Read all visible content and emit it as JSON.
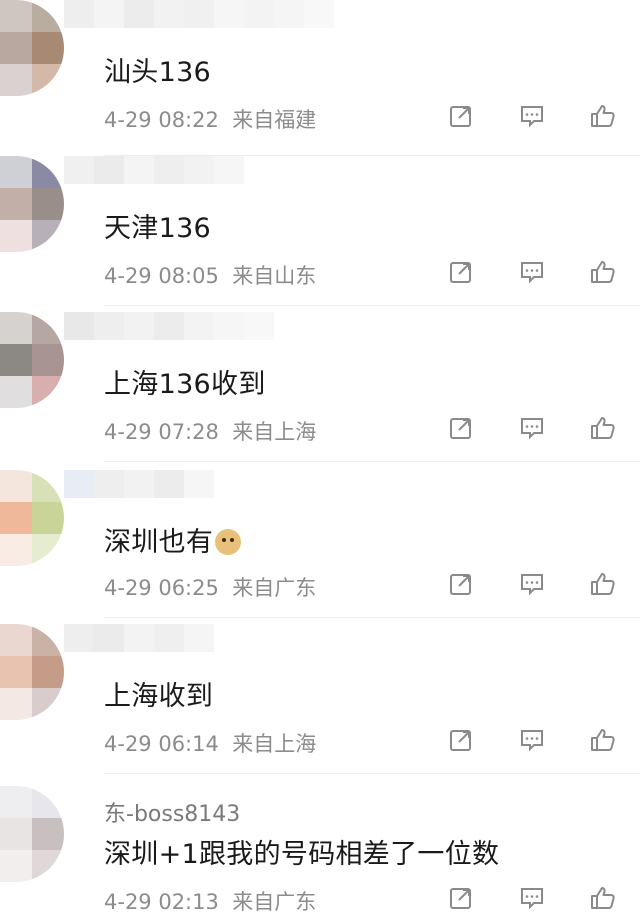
{
  "comments": [
    {
      "username": "",
      "text": "汕头136",
      "time": "4-29 08:22",
      "location": "来自福建"
    },
    {
      "username": "",
      "text": "天津136",
      "time": "4-29 08:05",
      "location": "来自山东"
    },
    {
      "username": "",
      "text": "上海136收到",
      "time": "4-29 07:28",
      "location": "来自上海"
    },
    {
      "username": "",
      "text": "深圳也有",
      "time": "4-29 06:25",
      "location": "来自广东",
      "emoji": "doge-emoji"
    },
    {
      "username": "",
      "text": "上海收到",
      "time": "4-29 06:14",
      "location": "来自上海"
    },
    {
      "username": "东-boss8143",
      "text": "深圳+1跟我的号码相差了一位数",
      "time": "4-29 02:13",
      "location": "来自广东"
    }
  ],
  "icons": {
    "share": "share-icon",
    "comment": "comment-icon",
    "like": "like-icon"
  },
  "colors": {
    "text": "#1a1a1a",
    "meta": "#8c8c8c",
    "icon": "#8a8a8a",
    "divider": "#ececec"
  }
}
